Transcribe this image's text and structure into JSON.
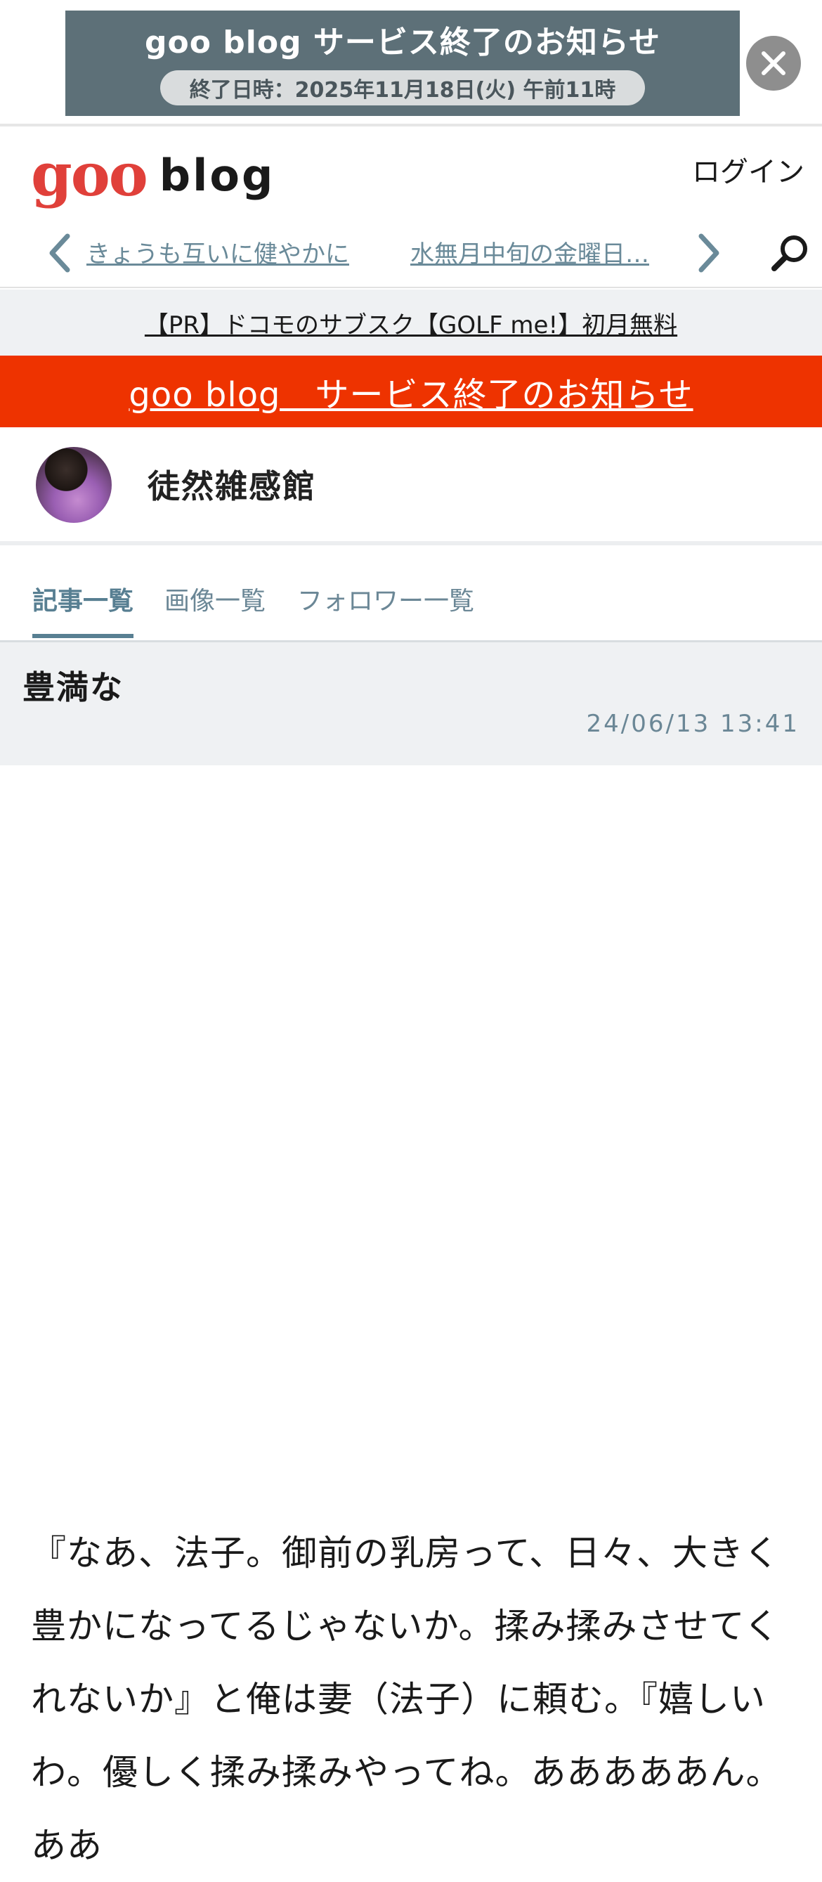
{
  "notice": {
    "title": "goo blog サービス終了のお知らせ",
    "date": "終了日時：2025年11月18日(火) 午前11時"
  },
  "header": {
    "logo_goo": "goo",
    "logo_blog": "blog",
    "login": "ログイン"
  },
  "article_nav": {
    "prev_title": "きょうも互いに健やかに",
    "next_title": "水無月中旬の金曜日…"
  },
  "pr": {
    "text": "【PR】ドコモのサブスク【GOLF me!】初月無料"
  },
  "service_end_banner": {
    "text": "goo blog　サービス終了のお知らせ"
  },
  "blog": {
    "name": "徒然雑感館"
  },
  "tabs": [
    {
      "label": "記事一覧",
      "active": true
    },
    {
      "label": "画像一覧",
      "active": false
    },
    {
      "label": "フォロワー一覧",
      "active": false
    }
  ],
  "entry": {
    "title": "豊満な",
    "date": "24/06/13 13:41",
    "body": "『なあ、法子。御前の乳房って、日々、大きく豊かになってるじゃないか。揉み揉みさせてくれないか』と俺は妻（法子）に頼む。『嬉しいわ。優しく揉み揉みやってね。あああああん。ああ"
  },
  "colors": {
    "accent": "#587f92",
    "brand_red": "#e0403a",
    "banner_red": "#ee3300",
    "notice_bg": "#5d7078"
  },
  "icons": [
    "close-icon",
    "chevron-left-icon",
    "chevron-right-icon",
    "search-icon"
  ]
}
